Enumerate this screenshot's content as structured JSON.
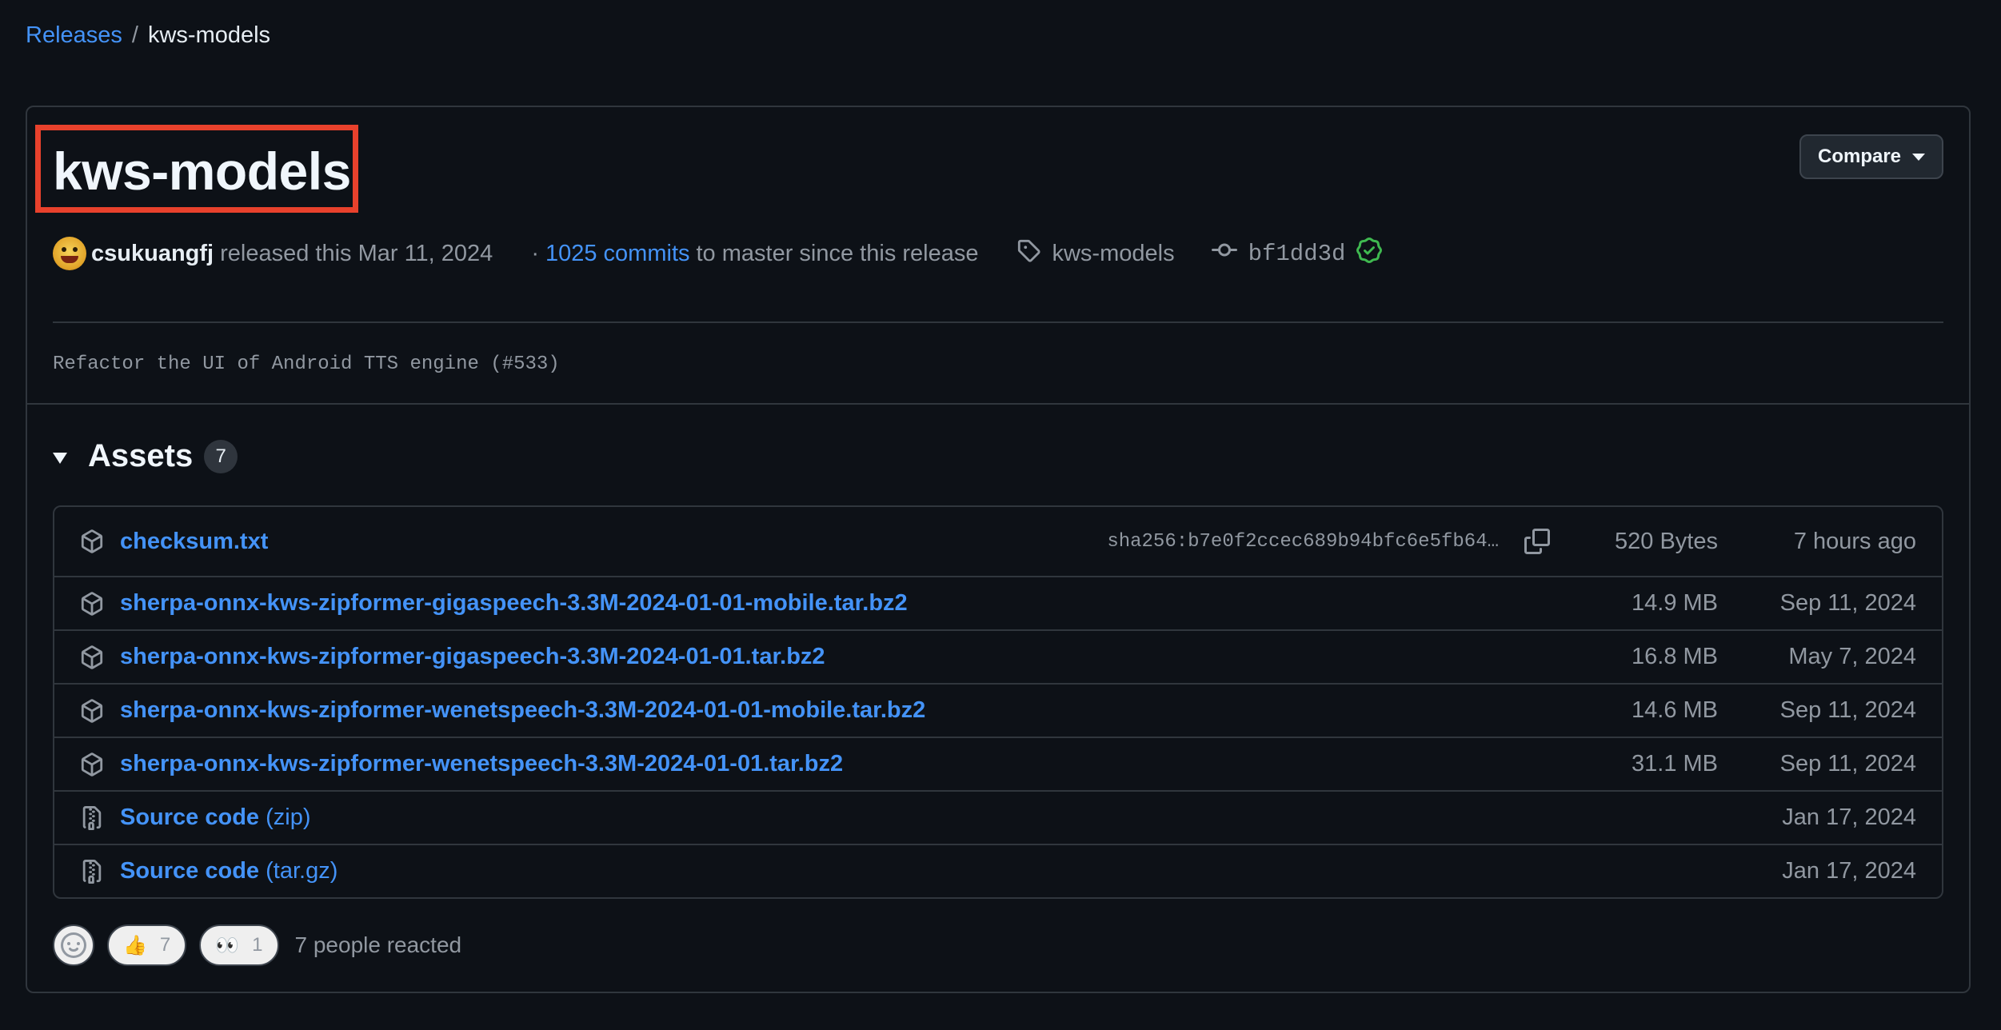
{
  "breadcrumb": {
    "root": "Releases",
    "separator": "/",
    "current": "kws-models"
  },
  "release": {
    "title": "kws-models",
    "compare_label": "Compare",
    "author": "csukuangfj",
    "released_text": "released this Mar 11, 2024",
    "commits_prefix": "·",
    "commits_link": "1025 commits",
    "commits_suffix": "to master since this release",
    "tag": "kws-models",
    "commit_sha": "bf1dd3d",
    "body": "Refactor the UI of Android TTS engine (#533)"
  },
  "assets": {
    "title": "Assets",
    "count": "7",
    "items": [
      {
        "name": "checksum.txt",
        "suffix": "",
        "digest": "sha256:b7e0f2ccec689b94bfc6e5fb64…",
        "size": "520 Bytes",
        "date": "7 hours ago",
        "icon": "package-icon"
      },
      {
        "name": "sherpa-onnx-kws-zipformer-gigaspeech-3.3M-2024-01-01-mobile.tar.bz2",
        "suffix": "",
        "digest": "",
        "size": "14.9 MB",
        "date": "Sep 11, 2024",
        "icon": "package-icon"
      },
      {
        "name": "sherpa-onnx-kws-zipformer-gigaspeech-3.3M-2024-01-01.tar.bz2",
        "suffix": "",
        "digest": "",
        "size": "16.8 MB",
        "date": "May 7, 2024",
        "icon": "package-icon"
      },
      {
        "name": "sherpa-onnx-kws-zipformer-wenetspeech-3.3M-2024-01-01-mobile.tar.bz2",
        "suffix": "",
        "digest": "",
        "size": "14.6 MB",
        "date": "Sep 11, 2024",
        "icon": "package-icon"
      },
      {
        "name": "sherpa-onnx-kws-zipformer-wenetspeech-3.3M-2024-01-01.tar.bz2",
        "suffix": "",
        "digest": "",
        "size": "31.1 MB",
        "date": "Sep 11, 2024",
        "icon": "package-icon"
      },
      {
        "name": "Source code",
        "suffix": "(zip)",
        "digest": "",
        "size": "",
        "date": "Jan 17, 2024",
        "icon": "file-zip-icon"
      },
      {
        "name": "Source code",
        "suffix": "(tar.gz)",
        "digest": "",
        "size": "",
        "date": "Jan 17, 2024",
        "icon": "file-zip-icon"
      }
    ]
  },
  "reactions": {
    "items": [
      {
        "emoji": "👍",
        "count": "7",
        "name": "thumbs-up"
      },
      {
        "emoji": "👀",
        "count": "1",
        "name": "eyes"
      }
    ],
    "summary": "7 people reacted"
  },
  "colors": {
    "background": "#0d1117",
    "link": "#4493f8",
    "border": "#30363d",
    "highlight": "#e8412c",
    "verified": "#3fb950"
  }
}
